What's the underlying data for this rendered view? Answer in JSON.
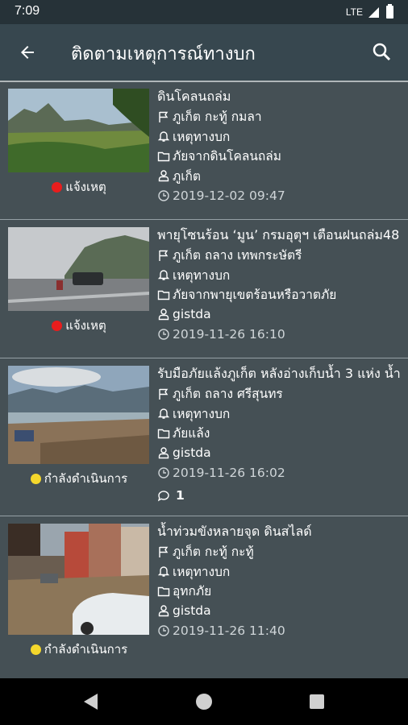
{
  "status_bar": {
    "time": "7:09",
    "network": "LTE"
  },
  "app_bar": {
    "title": "ติดตามเหตุการณ์ทางบก"
  },
  "colors": {
    "status_red": "#e81d1d",
    "status_yellow": "#f4d72c",
    "app_bar": "#37474f",
    "list_bg": "#455055"
  },
  "items": [
    {
      "title": "ดินโคลนถล่ม",
      "location": "ภูเก็ต กะทู้ กมลา",
      "category": "เหตุทางบก",
      "type": "ภัยจากดินโคลนถล่ม",
      "reporter": "ภูเก็ต",
      "datetime": "2019-12-02 09:47",
      "status": "แจ้งเหตุ",
      "status_color": "#e81d1d",
      "comments": null
    },
    {
      "title": "พายุโซนร้อน ‘มูน’ กรมอุตุฯ เตือนฝนถล่ม48",
      "location": "ภูเก็ต ถลาง เทพกระษัตรี",
      "category": "เหตุทางบก",
      "type": "ภัยจากพายุเขตร้อนหรือวาตภัย",
      "reporter": "gistda",
      "datetime": "2019-11-26 16:10",
      "status": "แจ้งเหตุ",
      "status_color": "#e81d1d",
      "comments": null
    },
    {
      "title": "รับมือภัยแล้งภูเก็ต หลังอ่างเก็บน้ำ 3 แห่ง น้ำ",
      "location": "ภูเก็ต ถลาง ศรีสุนทร",
      "category": "เหตุทางบก",
      "type": "ภัยแล้ง",
      "reporter": "gistda",
      "datetime": "2019-11-26 16:02",
      "status": "กำลังดำเนินการ",
      "status_color": "#f4d72c",
      "comments": "1"
    },
    {
      "title": "น้ำท่วมขังหลายจุด ดินสไลด์",
      "location": "ภูเก็ต กะทู้ กะทู้",
      "category": "เหตุทางบก",
      "type": "อุทกภัย",
      "reporter": "gistda",
      "datetime": "2019-11-26 11:40",
      "status": "กำลังดำเนินการ",
      "status_color": "#f4d72c",
      "comments": null
    }
  ]
}
